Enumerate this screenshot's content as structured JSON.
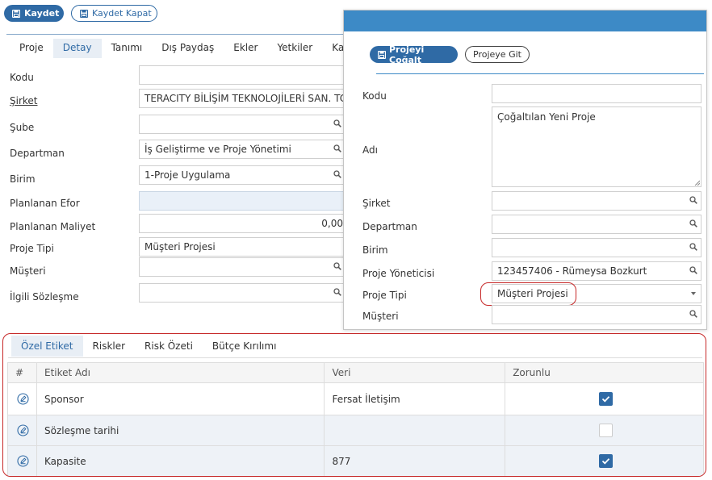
{
  "toolbar": {
    "save_label": "Kaydet",
    "save_close_label": "Kaydet Kapat"
  },
  "tabs": [
    "Proje",
    "Detay",
    "Tanımı",
    "Dış Paydaş",
    "Ekler",
    "Yetkiler",
    "Ka"
  ],
  "form": {
    "kodu": {
      "label": "Kodu",
      "value": ""
    },
    "sirket": {
      "label": "Şirket",
      "value": "TERACITY BİLİŞİM TEKNOLOJİLERİ SAN. TC"
    },
    "sube": {
      "label": "Şube",
      "value": ""
    },
    "departman": {
      "label": "Departman",
      "value": "İş Geliştirme ve Proje Yönetimi"
    },
    "birim": {
      "label": "Birim",
      "value": "1-Proje Uygulama"
    },
    "planlanan_efor": {
      "label": "Planlanan Efor",
      "value": ""
    },
    "planlanan_maliyet": {
      "label": "Planlanan Maliyet",
      "value": "0,00"
    },
    "proje_tipi": {
      "label": "Proje Tipi",
      "value": "Müşteri Projesi"
    },
    "musteri": {
      "label": "Müşteri",
      "value": ""
    },
    "ilgili_sozlesme": {
      "label": "İlgili Sözleşme",
      "value": ""
    }
  },
  "bottom_tabs": [
    "Özel Etiket",
    "Riskler",
    "Risk Özeti",
    "Bütçe Kırılımı"
  ],
  "grid": {
    "headers": [
      "#",
      "Etiket Adı",
      "Veri",
      "Zorunlu"
    ],
    "rows": [
      {
        "name": "Sponsor",
        "value": "Fersat İletişim",
        "required": true
      },
      {
        "name": "Sözleşme tarihi",
        "value": "",
        "required": false
      },
      {
        "name": "Kapasite",
        "value": "877",
        "required": true
      }
    ]
  },
  "dialog": {
    "duplicate_label": "Projeyi Çoğalt",
    "goto_label": "Projeye Git",
    "kodu": {
      "label": "Kodu",
      "value": ""
    },
    "adi": {
      "label": "Adı",
      "value": "Çoğaltılan Yeni Proje"
    },
    "sirket": {
      "label": "Şirket",
      "value": ""
    },
    "departman": {
      "label": "Departman",
      "value": ""
    },
    "birim": {
      "label": "Birim",
      "value": ""
    },
    "proje_yoneticisi": {
      "label": "Proje Yöneticisi",
      "value": "123457406 - Rümeysa Bozkurt"
    },
    "proje_tipi": {
      "label": "Proje Tipi",
      "value": "Müşteri Projesi"
    },
    "musteri": {
      "label": "Müşteri",
      "value": ""
    }
  },
  "icons": [
    "floppy-icon",
    "search-icon",
    "edit-icon",
    "checkbox-icon",
    "chevron-down-icon"
  ],
  "colors": {
    "accent": "#2f6aa5",
    "dialog_header": "#3d8ac6",
    "highlight": "#c62828"
  }
}
